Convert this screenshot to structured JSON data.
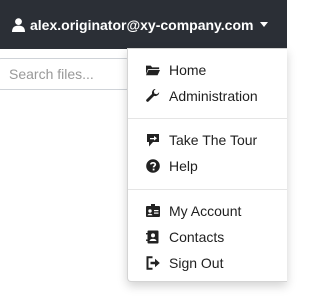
{
  "user_menu": {
    "email": "alex.originator@xy-company.com"
  },
  "search": {
    "placeholder": "Search files..."
  },
  "menu": {
    "home": "Home",
    "administration": "Administration",
    "tour": "Take The Tour",
    "help": "Help",
    "account": "My Account",
    "contacts": "Contacts",
    "signout": "Sign Out"
  },
  "icons": {
    "user": "user-icon",
    "caret": "caret-down-icon",
    "home": "folder-open-icon",
    "administration": "wrench-icon",
    "tour": "signpost-icon",
    "help": "question-circle-icon",
    "account": "id-card-icon",
    "contacts": "address-book-icon",
    "signout": "sign-out-icon"
  },
  "colors": {
    "topbar": "#2b2f36",
    "menu_text": "#1f1f1f",
    "divider": "#e5e5e5"
  }
}
